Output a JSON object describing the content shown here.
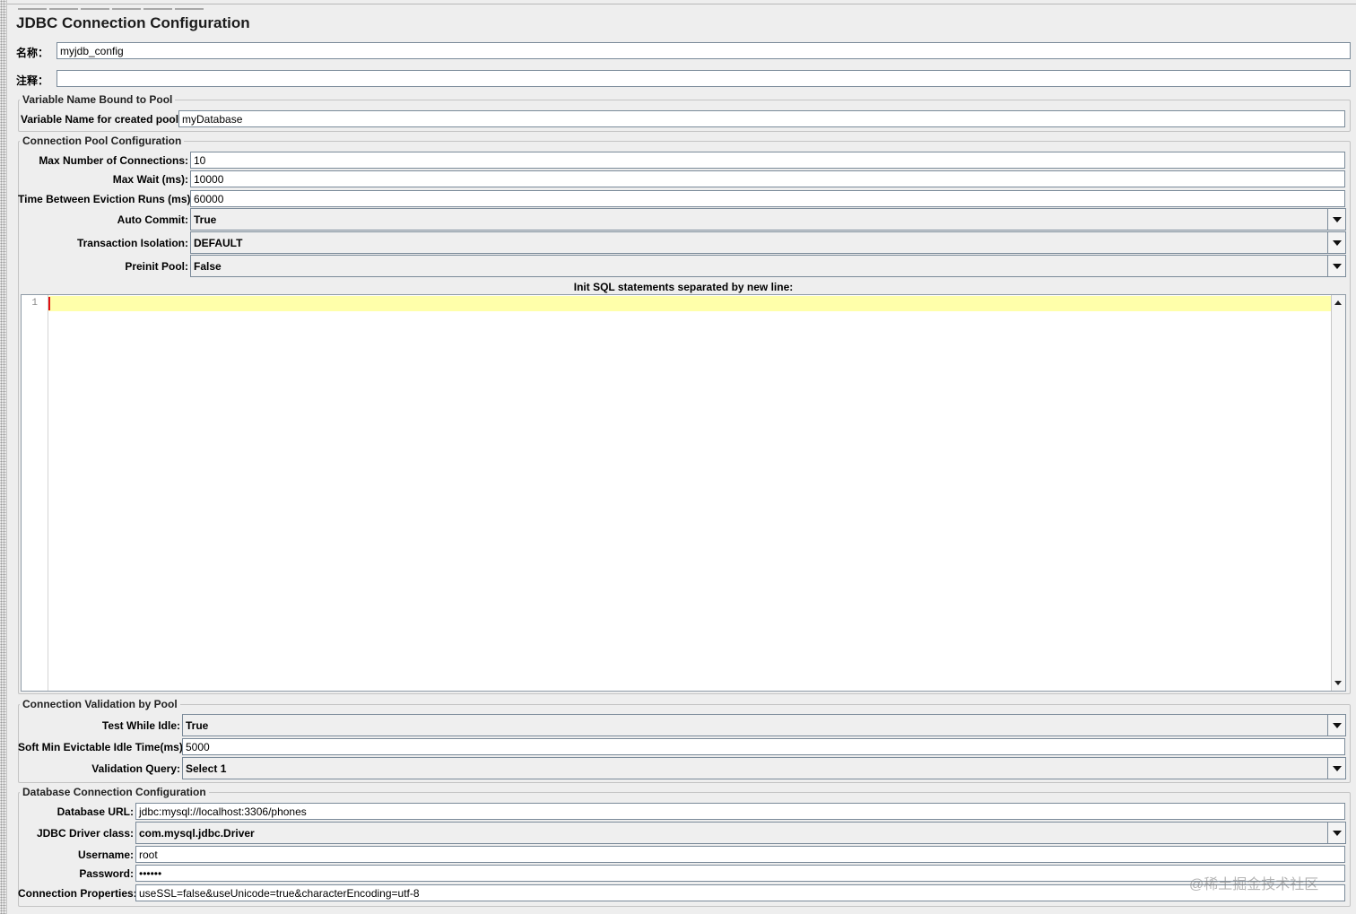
{
  "panel": {
    "title": "JDBC Connection Configuration",
    "name_label": "名称：",
    "name_value": "myjdb_config",
    "comment_label": "注释：",
    "comment_value": ""
  },
  "variable_group": {
    "legend": "Variable Name Bound to Pool",
    "pool_var_label": "Variable Name for created pool:",
    "pool_var_value": "myDatabase"
  },
  "pool_group": {
    "legend": "Connection Pool Configuration",
    "max_connections_label": "Max Number of Connections:",
    "max_connections_value": "10",
    "max_wait_label": "Max Wait (ms):",
    "max_wait_value": "10000",
    "eviction_label": "Time Between Eviction Runs (ms):",
    "eviction_value": "60000",
    "auto_commit_label": "Auto Commit:",
    "auto_commit_value": "True",
    "isolation_label": "Transaction Isolation:",
    "isolation_value": "DEFAULT",
    "preinit_label": "Preinit Pool:",
    "preinit_value": "False",
    "init_sql_label": "Init SQL statements separated by new line:",
    "editor_line_number": "1"
  },
  "validation_group": {
    "legend": "Connection Validation by Pool",
    "test_idle_label": "Test While Idle:",
    "test_idle_value": "True",
    "soft_min_label": "Soft Min Evictable Idle Time(ms):",
    "soft_min_value": "5000",
    "query_label": "Validation Query:",
    "query_value": "Select 1"
  },
  "db_group": {
    "legend": "Database Connection Configuration",
    "url_label": "Database URL:",
    "url_value": "jdbc:mysql://localhost:3306/phones",
    "driver_label": "JDBC Driver class:",
    "driver_value": "com.mysql.jdbc.Driver",
    "username_label": "Username:",
    "username_value": "root",
    "password_label": "Password:",
    "password_value": "••••••",
    "props_label": "Connection Properties:",
    "props_value": "useSSL=false&useUnicode=true&characterEncoding=utf-8"
  },
  "watermark": "@稀土掘金技术社区",
  "icons": {
    "dropdown": "chevron-down-icon",
    "scroll_up": "scroll-up-icon",
    "scroll_down": "scroll-down-icon"
  },
  "colors": {
    "background": "#eeeeee",
    "current_line": "#ffffaa",
    "caret": "#e01010",
    "field_border": "#7a8a99"
  }
}
